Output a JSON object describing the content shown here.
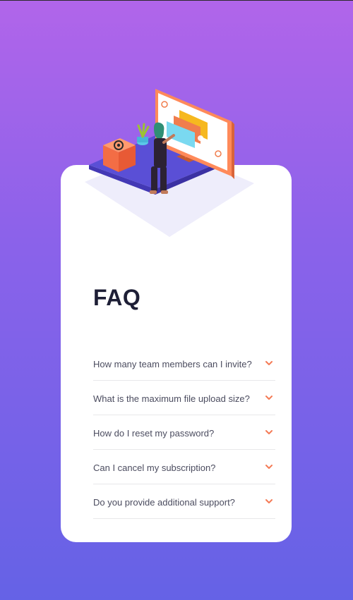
{
  "page": {
    "title": "FAQ"
  },
  "faq": {
    "items": [
      {
        "question": "How many team members can I invite?"
      },
      {
        "question": "What is the maximum file upload size?"
      },
      {
        "question": "How do I reset my password?"
      },
      {
        "question": "Can I cancel my subscription?"
      },
      {
        "question": "Do you provide additional support?"
      }
    ],
    "expand_icon": "chevron-down-icon"
  },
  "colors": {
    "background_top": "#b165ea",
    "background_bottom": "#6562e6",
    "card": "#ffffff",
    "title": "#1e1f36",
    "question_text": "#4b4c5f",
    "divider": "#e8e8ea",
    "accent": "#f47b56"
  },
  "illustration": {
    "icon": "woman-at-computer-illustration"
  }
}
